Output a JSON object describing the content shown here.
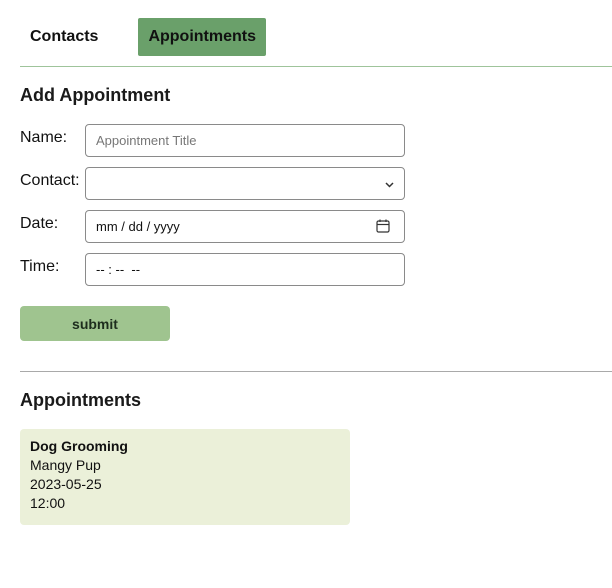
{
  "nav": {
    "tabs": [
      {
        "label": "Contacts",
        "active": false
      },
      {
        "label": "Appointments",
        "active": true
      }
    ],
    "accent_color": "#6aa06a"
  },
  "form": {
    "heading": "Add Appointment",
    "name_label": "Name:",
    "name_placeholder": "Appointment Title",
    "name_value": "",
    "contact_label": "Contact:",
    "contact_value": "",
    "date_label": "Date:",
    "date_placeholder": "mm / dd / yyyy",
    "time_label": "Time:",
    "time_placeholder": "-- : --  --",
    "submit_label": "submit"
  },
  "appointments": {
    "heading": "Appointments",
    "items": [
      {
        "title": "Dog Grooming",
        "contact": "Mangy Pup",
        "date": "2023-05-25",
        "time": "12:00"
      }
    ],
    "card_color": "#ebf0d9"
  },
  "icons": {
    "calendar": "calendar-icon",
    "select": "chevron-down-icon"
  }
}
